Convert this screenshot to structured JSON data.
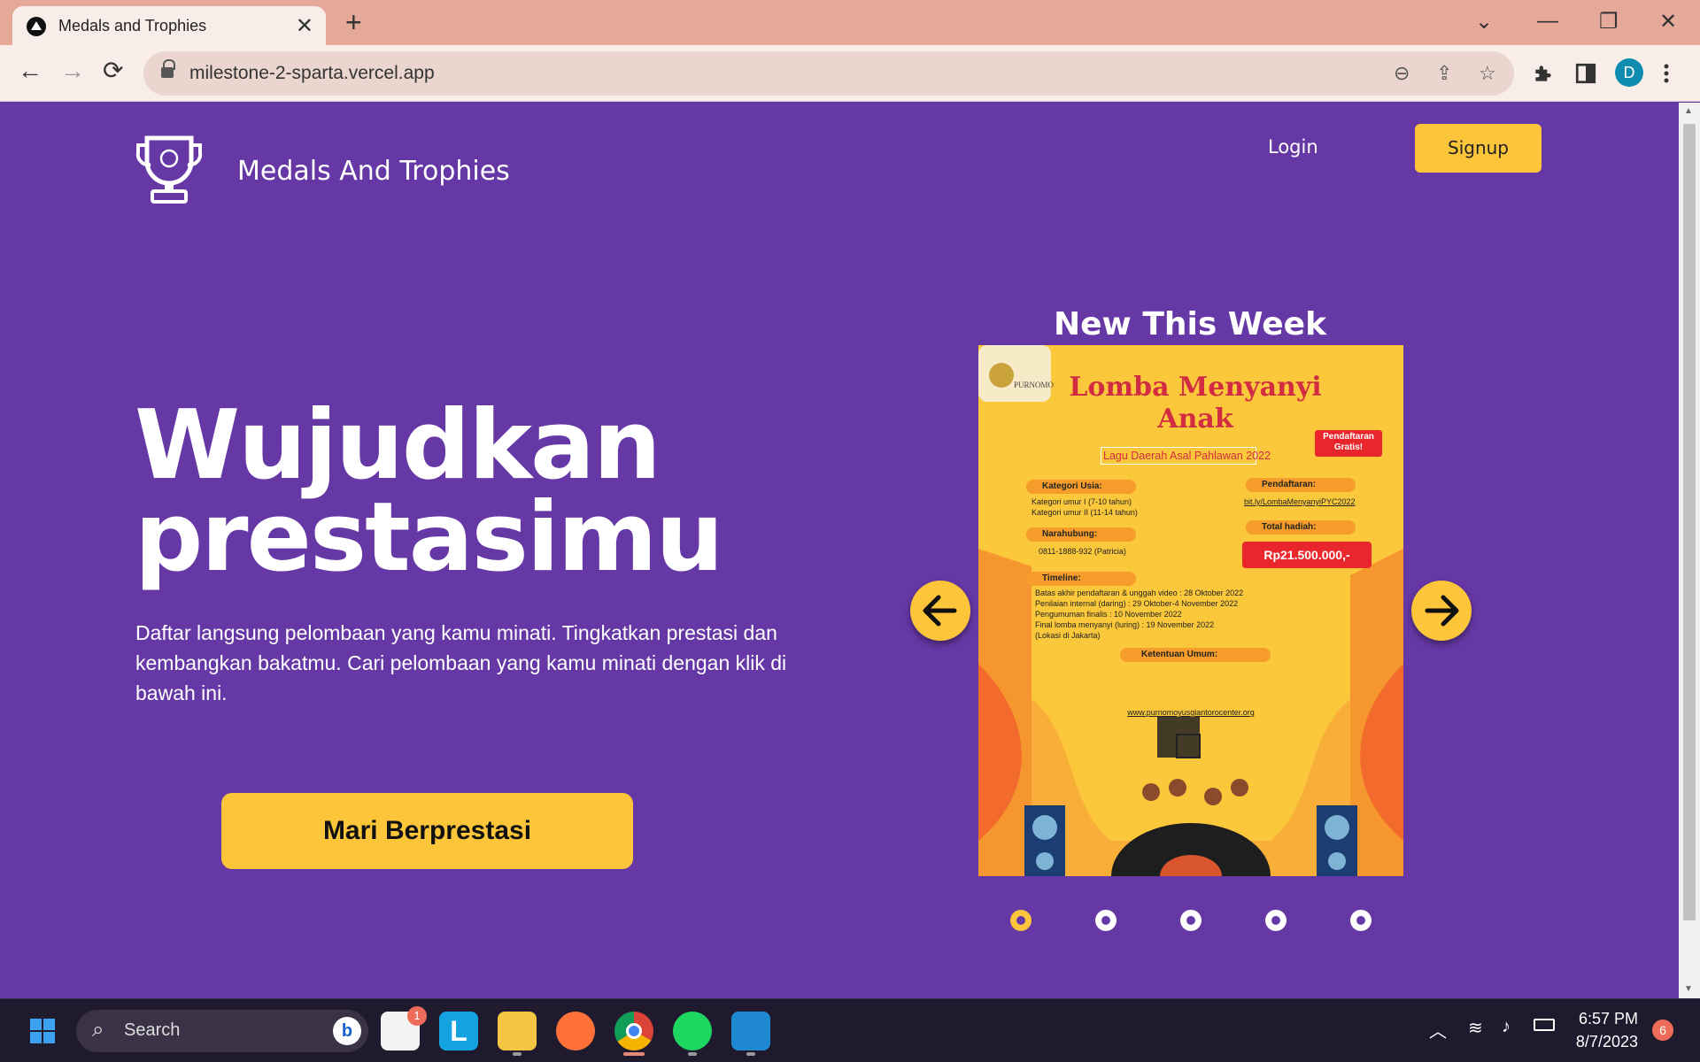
{
  "browser": {
    "tab_title": "Medals and Trophies",
    "tab_close": "✕",
    "new_tab": "+",
    "url": "milestone-2-sparta.vercel.app",
    "back": "←",
    "forward": "→",
    "reload": "⟳",
    "minimize": "—",
    "restore": "❐",
    "close": "✕",
    "tab_menu": "⌄",
    "zoom_icon": "⊖",
    "share_icon": "⇪",
    "star_icon": "☆",
    "avatar_letter": "D"
  },
  "nav": {
    "brand": "Medals And Trophies",
    "login": "Login",
    "signup": "Signup"
  },
  "hero": {
    "title_line1": "Wujudkan",
    "title_line2": "prestasimu",
    "description": "Daftar langsung pelombaan yang kamu minati. Tingkatkan prestasi dan kembangkan bakatmu. Cari pelombaan yang kamu minati dengan klik di bawah ini.",
    "cta": "Mari Berprestasi"
  },
  "carousel": {
    "heading": "New This Week",
    "active_index": 0,
    "slide_count": 5,
    "poster": {
      "logo_text": "PURNOMO",
      "title": "Lomba Menyanyi Anak",
      "subtitle": "Lagu Daerah Asal Pahlawan 2022",
      "badge": "Pendaftaran Gratis!",
      "kategori_label": "Kategori Usia:",
      "kategori_1": "Kategori umur I (7-10 tahun)",
      "kategori_2": "Kategori umur II (11-14 tahun)",
      "narahubung_label": "Narahubung:",
      "narahubung": "0811-1888-932 (Patricia)",
      "pendaftaran_label": "Pendaftaran:",
      "pendaftaran_link": "bit.ly/LombaMenyanyiPYC2022",
      "hadiah_label": "Total hadiah:",
      "hadiah": "Rp21.500.000,-",
      "timeline_label": "Timeline:",
      "timeline": [
        "Batas akhir pendaftaran & unggah video : 28 Oktober 2022",
        "Penilaian internal (daring) : 29 Oktober-4 November 2022",
        "Pengumuman finalis : 10 November 2022",
        "Final lomba menyanyi (luring) : 19 November 2022",
        "(Lokasi di Jakarta)"
      ],
      "ketentuan_label": "Ketentuan Umum:",
      "website": "www.purnomoyusgiantorocenter.org"
    }
  },
  "taskbar": {
    "search_placeholder": "Search",
    "store_badge": "1",
    "time": "6:57 PM",
    "date": "8/7/2023",
    "notifications": "6"
  }
}
